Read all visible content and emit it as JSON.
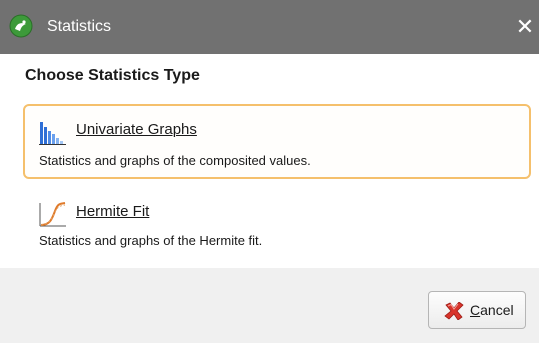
{
  "window": {
    "title": "Statistics",
    "app_icon": "leapfrog-logo-icon",
    "close_symbol": "✕"
  },
  "heading": "Choose Statistics Type",
  "options": [
    {
      "icon": "histogram-icon",
      "title_first": "U",
      "title_rest": "nivariate Graphs",
      "description": "Statistics and graphs of the composited values.",
      "selected": true
    },
    {
      "icon": "hermite-curve-icon",
      "title_first": "H",
      "title_rest": "ermite Fit",
      "description": "Statistics and graphs of the Hermite fit.",
      "selected": false
    }
  ],
  "footer": {
    "cancel_first": "C",
    "cancel_rest": "ancel",
    "cancel_icon": "red-x-icon"
  },
  "colors": {
    "titlebar": "#717171",
    "selection_border": "#f5c06c",
    "footer_bg": "#f0f0f0"
  }
}
